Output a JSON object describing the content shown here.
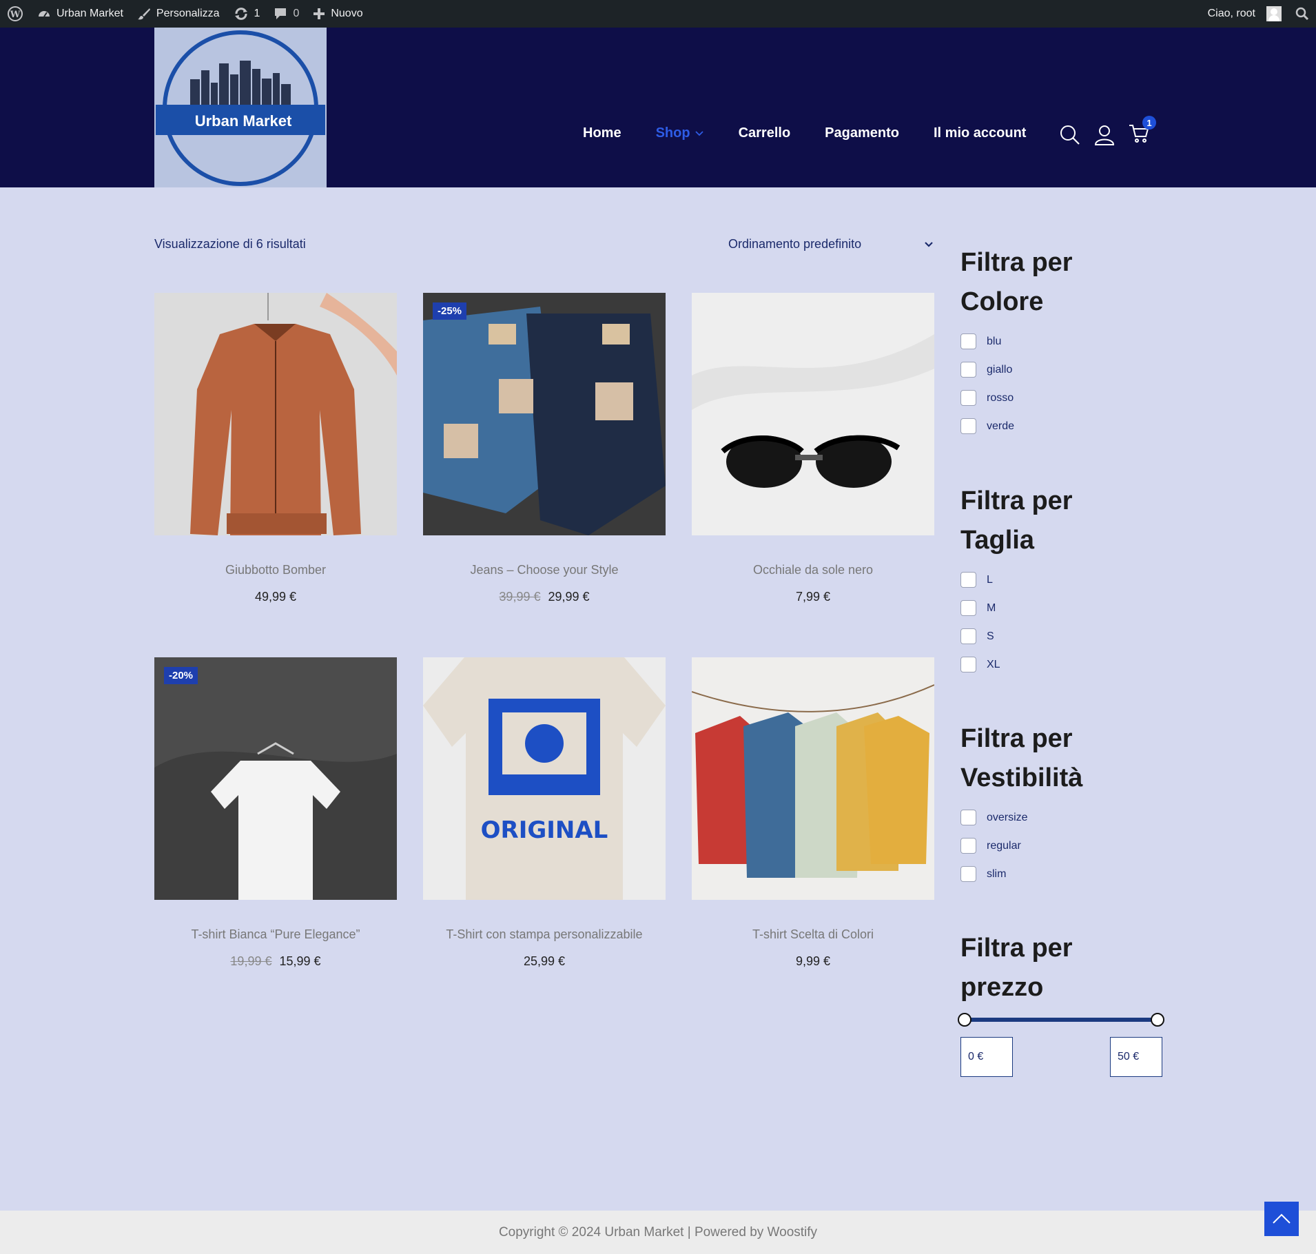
{
  "admin_bar": {
    "site_name": "Urban Market",
    "customize": "Personalizza",
    "updates_count": "1",
    "comments_count": "0",
    "new_label": "Nuovo",
    "greeting": "Ciao, root"
  },
  "header": {
    "logo_text": "Urban Market",
    "nav": [
      "Home",
      "Shop",
      "Carrello",
      "Pagamento",
      "Il mio account"
    ],
    "cart_count": "1"
  },
  "shop": {
    "result_count": "Visualizzazione di 6 risultati",
    "ordering": "Ordinamento predefinito",
    "products": [
      {
        "name": "Giubbotto Bomber",
        "price": "49,99 €",
        "old_price": "",
        "sale": ""
      },
      {
        "name": "Jeans – Choose your Style",
        "price": "29,99 €",
        "old_price": "39,99 €",
        "sale": "-25%"
      },
      {
        "name": "Occhiale da sole nero",
        "price": "7,99 €",
        "old_price": "",
        "sale": ""
      },
      {
        "name": "T-shirt Bianca “Pure Elegance”",
        "price": "15,99 €",
        "old_price": "19,99 €",
        "sale": "-20%"
      },
      {
        "name": "T-Shirt con stampa personalizzabile",
        "price": "25,99 €",
        "old_price": "",
        "sale": ""
      },
      {
        "name": "T-shirt Scelta di Colori",
        "price": "9,99 €",
        "old_price": "",
        "sale": ""
      }
    ]
  },
  "sidebar": {
    "color": {
      "title_1": "Filtra per",
      "title_2": "Colore",
      "items": [
        "blu",
        "giallo",
        "rosso",
        "verde"
      ]
    },
    "size": {
      "title_1": "Filtra per",
      "title_2": "Taglia",
      "items": [
        "L",
        "M",
        "S",
        "XL"
      ]
    },
    "fit": {
      "title_1": "Filtra per",
      "title_2": "Vestibilità",
      "items": [
        "oversize",
        "regular",
        "slim"
      ]
    },
    "price": {
      "title_1": "Filtra per",
      "title_2": "prezzo",
      "min": "0 €",
      "max": "50 €"
    }
  },
  "footer": {
    "text": "Copyright © 2024 Urban Market | Powered by Woostify"
  },
  "colors": {
    "header_bg": "#0e0e48",
    "page_bg": "#d5d9ef",
    "accent": "#1e4fd8",
    "shop_active": "#2e5ce6"
  }
}
